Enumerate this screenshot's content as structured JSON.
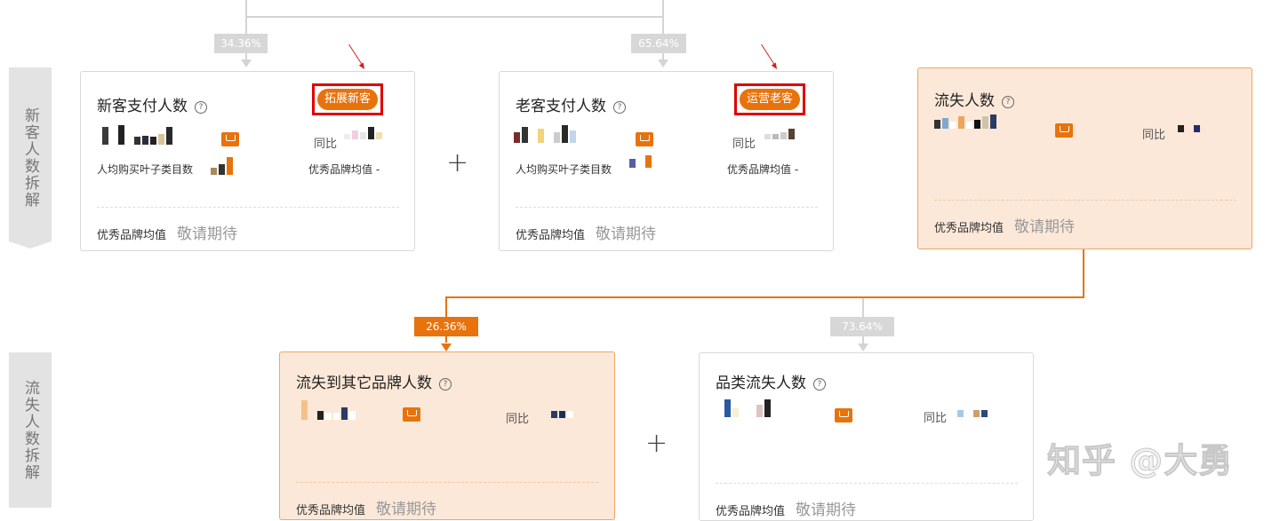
{
  "percentages": {
    "new_share": "34.36%",
    "old_share": "65.64%",
    "churn_other_brand_share": "26.36%",
    "churn_category_share": "73.64%"
  },
  "side_labels": {
    "new_customer": "新客人数拆解",
    "churn": "流失人数拆解"
  },
  "common": {
    "yoy_label": "同比",
    "help_glyph": "?",
    "bench_label": "优秀品牌均值",
    "bench_value": "敬请期待",
    "per_capita_label": "人均购买叶子类目数",
    "bench_dash": "优秀品牌均值 -",
    "plus": "+"
  },
  "cards": {
    "new_pay": {
      "title": "新客支付人数",
      "action": "拓展新客"
    },
    "old_pay": {
      "title": "老客支付人数",
      "action": "运营老客"
    },
    "churn": {
      "title": "流失人数"
    },
    "churn_other_brand": {
      "title": "流失到其它品牌人数"
    },
    "category_churn": {
      "title": "品类流失人数"
    }
  },
  "watermark": "知乎 @大勇",
  "colors": {
    "accent": "#e8730c",
    "highlight_border": "#e00000",
    "orange_card_bg": "#fce8d8"
  }
}
